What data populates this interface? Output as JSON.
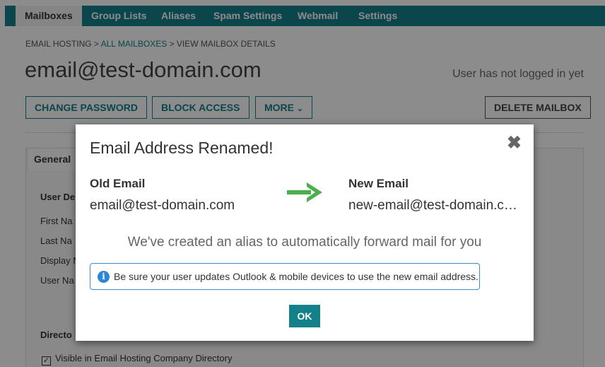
{
  "nav": {
    "tabs": [
      {
        "label": "Mailboxes"
      },
      {
        "label": "Group Lists"
      },
      {
        "label": "Aliases"
      },
      {
        "label": "Spam Settings"
      },
      {
        "label": "Webmail"
      },
      {
        "label": "Settings"
      }
    ],
    "active_tab": "Mailboxes"
  },
  "breadcrumb": {
    "root": "EMAIL HOSTING",
    "sep1": ">",
    "mid": "ALL MAILBOXES",
    "sep2": ">",
    "current": "VIEW MAILBOX DETAILS"
  },
  "page": {
    "title": "email@test-domain.com",
    "login_status": "User has not logged in yet"
  },
  "actions": {
    "change_password": "CHANGE PASSWORD",
    "block_access": "BLOCK ACCESS",
    "more": "MORE",
    "more_icon": "⌄",
    "delete_mailbox": "DELETE MAILBOX"
  },
  "details": {
    "tab_general": "General",
    "section_user": "User De",
    "fields": [
      "First Na",
      "Last Na",
      "Display N",
      "User Na"
    ],
    "section_directory": "Directo",
    "checkbox_label": "Visible in Email Hosting Company Directory",
    "checkbox_checked": true
  },
  "modal": {
    "title": "Email Address Renamed!",
    "close_glyph": "✖",
    "old_heading": "Old Email",
    "old_value": "email@test-domain.com",
    "new_heading": "New Email",
    "new_value": "new-email@test-domain.com",
    "forward_message": "We've created an alias to automatically forward mail for you",
    "info_glyph": "i",
    "info_text": "Be sure your user updates Outlook & mobile devices to use the new email address.",
    "ok_label": "OK"
  },
  "colors": {
    "brand": "#13808a",
    "arrow": "#4cae4c",
    "info": "#2f86d6"
  }
}
